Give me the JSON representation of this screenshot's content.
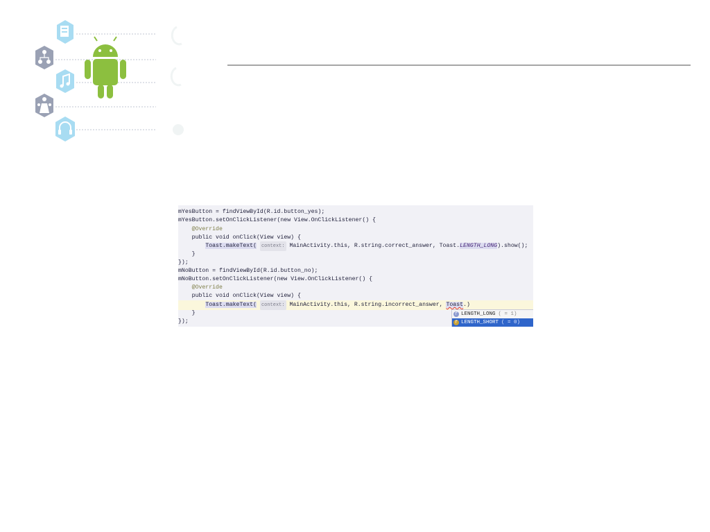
{
  "decor": {
    "icons": [
      "server-icon",
      "network-icon",
      "music-note-icon",
      "people-icon",
      "headphones-icon",
      "android-robot-icon"
    ],
    "colors": {
      "hexagon": "#9fd6ef",
      "hexagon_gray": "#9aa1b4",
      "android_green": "#8cbf3f",
      "rule": "#a6a6a6"
    }
  },
  "code": {
    "lines": [
      {
        "indent": "",
        "text": "mYesButton = findViewById(R.id.button_yes);"
      },
      {
        "indent": "",
        "text": "mYesButton.setOnClickListener(new View.OnClickListener() {"
      },
      {
        "indent": "    ",
        "text": "@Override"
      },
      {
        "indent": "    ",
        "text": "public void onClick(View view) {"
      },
      {
        "indent": "        ",
        "pre": "Toast.makeText(",
        "hint": "context:",
        "post": " MainActivity.this, R.string.correct_answer, Toast.",
        "italic": "LENGTH_LONG",
        "end": ").show();"
      },
      {
        "indent": "    ",
        "text": "}"
      },
      {
        "indent": "",
        "text": "});"
      },
      {
        "indent": "",
        "text": "mNoButton = findViewById(R.id.button_no);"
      },
      {
        "indent": "",
        "text": "mNoButton.setOnClickListener(new View.OnClickListener() {"
      },
      {
        "indent": "    ",
        "text": "@Override"
      },
      {
        "indent": "    ",
        "text": "public void onClick(View view) {"
      },
      {
        "indent": "        ",
        "pre": "Toast.makeText(",
        "hint": "context:",
        "post": " MainActivity.this, R.string.incorrect_answer, ",
        "err": "Toast",
        "end": ".)"
      },
      {
        "indent": "    ",
        "text": "}"
      },
      {
        "indent": "",
        "text": "});"
      }
    ],
    "autocomplete": [
      {
        "label": "LENGTH_LONG",
        "tail": "( = 1)",
        "selected": false
      },
      {
        "label": "LENGTH_SHORT",
        "tail": "( = 0)",
        "selected": true
      }
    ]
  }
}
